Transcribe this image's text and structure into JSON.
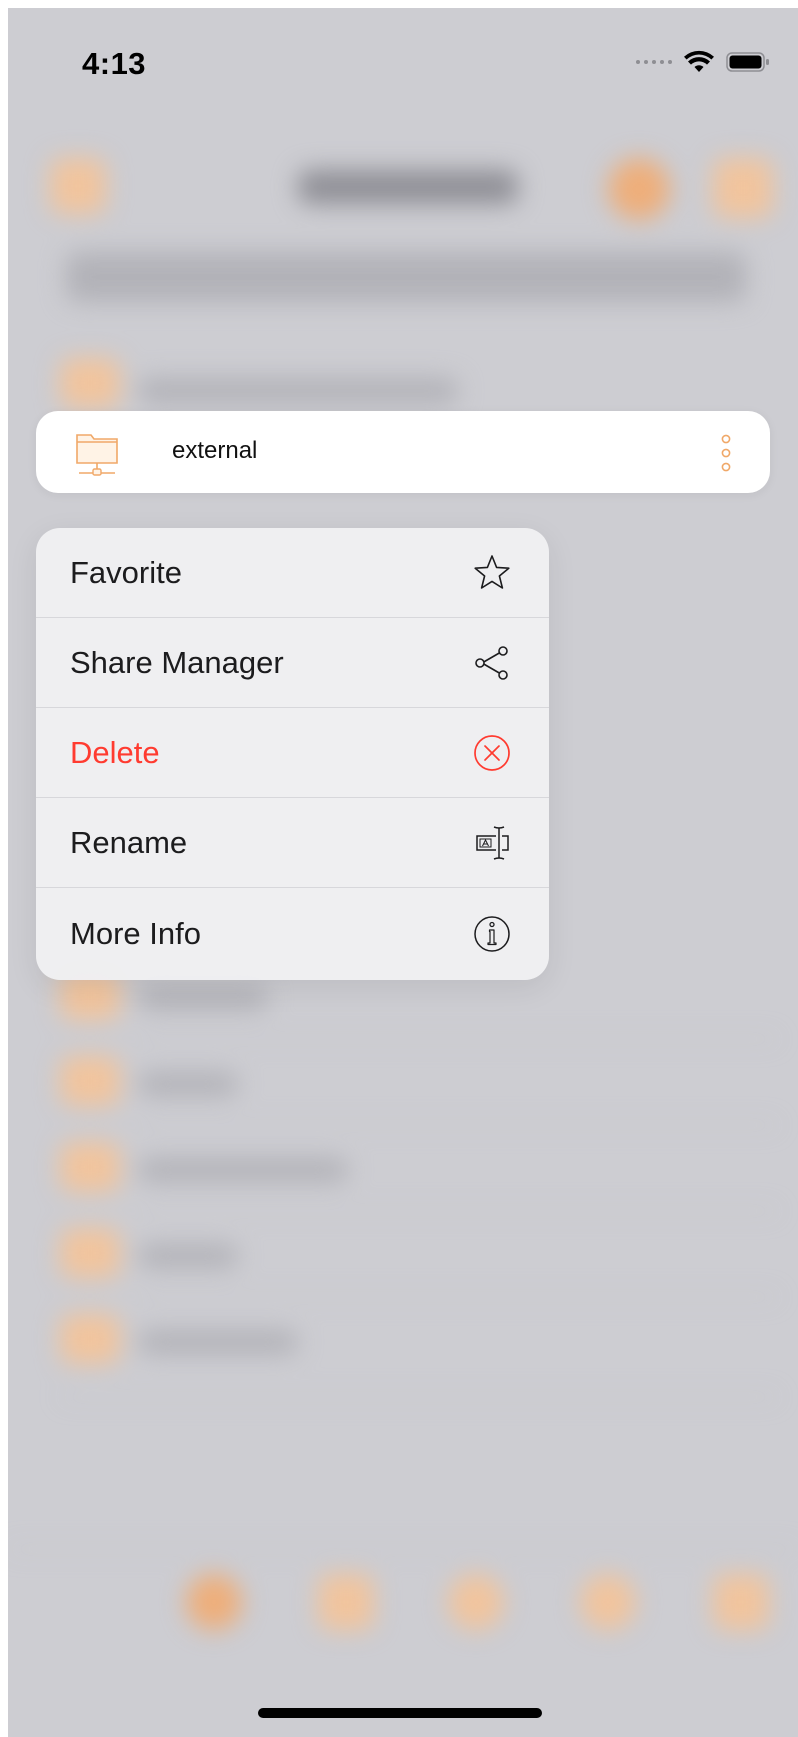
{
  "status_bar": {
    "time": "4:13"
  },
  "preview_row": {
    "label": "external",
    "icon": "network-folder-icon"
  },
  "context_menu": {
    "items": [
      {
        "label": "Favorite",
        "icon": "star-icon",
        "destructive": false
      },
      {
        "label": "Share Manager",
        "icon": "share-icon",
        "destructive": false
      },
      {
        "label": "Delete",
        "icon": "delete-circle-x-icon",
        "destructive": true
      },
      {
        "label": "Rename",
        "icon": "rename-icon",
        "destructive": false
      },
      {
        "label": "More Info",
        "icon": "info-icon",
        "destructive": false
      }
    ]
  },
  "colors": {
    "accent": "#f0a868",
    "destructive": "#ff3b30",
    "backdrop": "#cdcdd2",
    "menu_background": "#f0f0f2"
  }
}
